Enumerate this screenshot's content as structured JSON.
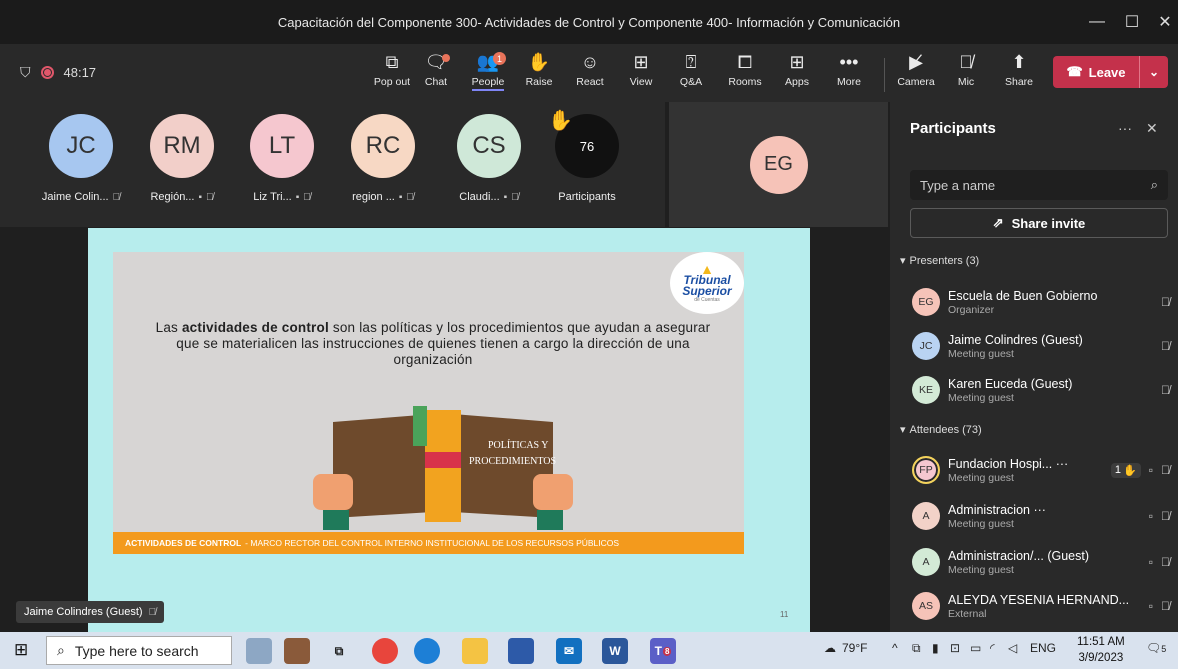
{
  "window": {
    "title": "Capacitación del Componente 300- Actividades de Control y Componente 400- Información y Comunicación",
    "minimize": "—",
    "maximize": "☐",
    "close": "✕"
  },
  "toolbar": {
    "timer": "48:17",
    "buttons": [
      {
        "label": "Pop out",
        "icon": "pop-out-icon"
      },
      {
        "label": "Chat",
        "icon": "chat-icon"
      },
      {
        "label": "People",
        "icon": "people-icon",
        "badge": "1"
      },
      {
        "label": "Raise",
        "icon": "raise-hand-icon"
      },
      {
        "label": "React",
        "icon": "react-icon"
      },
      {
        "label": "View",
        "icon": "view-icon"
      },
      {
        "label": "Q&A",
        "icon": "qa-icon"
      },
      {
        "label": "Rooms",
        "icon": "rooms-icon"
      },
      {
        "label": "Apps",
        "icon": "apps-icon"
      },
      {
        "label": "More",
        "icon": "more-icon"
      }
    ],
    "media": [
      {
        "label": "Camera",
        "icon": "camera-off-icon"
      },
      {
        "label": "Mic",
        "icon": "mic-off-icon"
      },
      {
        "label": "Share",
        "icon": "share-icon"
      }
    ],
    "leave_label": "Leave",
    "accent": "#7f85f5",
    "leave_color": "#c4314b"
  },
  "gallery": {
    "tiles": [
      {
        "initials": "JC",
        "name": "Jaime Colin...",
        "color": "#a7c7f0"
      },
      {
        "initials": "RM",
        "name": "Región...",
        "color": "#f2cfc9"
      },
      {
        "initials": "LT",
        "name": "Liz Tri...",
        "color": "#f5c7cf"
      },
      {
        "initials": "RC",
        "name": "region ...",
        "color": "#f7d8c4"
      },
      {
        "initials": "CS",
        "name": "Claudi...",
        "color": "#cfe8d8"
      }
    ],
    "participants_count": "76",
    "participants_label": "Participants",
    "featured_initials": "EG"
  },
  "slide": {
    "text_pre": "Las ",
    "text_bold": "actividades de control",
    "text_post": " son las políticas y los procedimientos que ayudan a asegurar que se materialicen las instrucciones de quienes tienen a cargo la dirección de una organización",
    "book_text_1": "POLÍTICAS Y",
    "book_text_2": "PROCEDIMIENTOS",
    "logo_line1": "Tribunal",
    "logo_line2": "Superior",
    "logo_sub": "de Cuentas",
    "bar_bold": "ACTIVIDADES DE CONTROL",
    "bar_rest": "- MARCO RECTOR DEL CONTROL INTERNO INSTITUCIONAL DE LOS RECURSOS PÚBLICOS",
    "page": "11",
    "speaker_chip": "Jaime Colindres (Guest)"
  },
  "panel": {
    "title": "Participants",
    "more": "···",
    "close": "✕",
    "search_placeholder": "Type a name",
    "share_invite": "Share invite",
    "presenters_label": "Presenters (3)",
    "attendees_label": "Attendees (73)",
    "presenters": [
      {
        "initials": "EG",
        "name": "Escuela de Buen Gobierno",
        "role": "Organizer",
        "color": "#f6c3b8"
      },
      {
        "initials": "JC",
        "name": "Jaime Colindres (Guest)",
        "role": "Meeting guest",
        "color": "#b9d3f2"
      },
      {
        "initials": "KE",
        "name": "Karen Euceda (Guest)",
        "role": "Meeting guest",
        "color": "#d3ead6"
      }
    ],
    "attendees": [
      {
        "initials": "FP",
        "name": "Fundacion Hospi... ···",
        "role": "Meeting guest",
        "color": "#f5c7cf",
        "raise": "1"
      },
      {
        "initials": "A",
        "name": "Administracion ···",
        "role": "Meeting guest",
        "color": "#f2d2c8"
      },
      {
        "initials": "A",
        "name": "Administracion/...  (Guest)",
        "role": "Meeting guest",
        "color": "#d3ead6"
      },
      {
        "initials": "AS",
        "name": "ALEYDA YESENIA HERNAND...",
        "role": "External",
        "color": "#f6c3b8"
      }
    ]
  },
  "taskbar": {
    "search_placeholder": "Type here to search",
    "weather": "79°F",
    "lang": "ENG",
    "time": "11:51 AM",
    "date": "3/9/2023",
    "notif_count": "5",
    "teams_badge": "8"
  }
}
